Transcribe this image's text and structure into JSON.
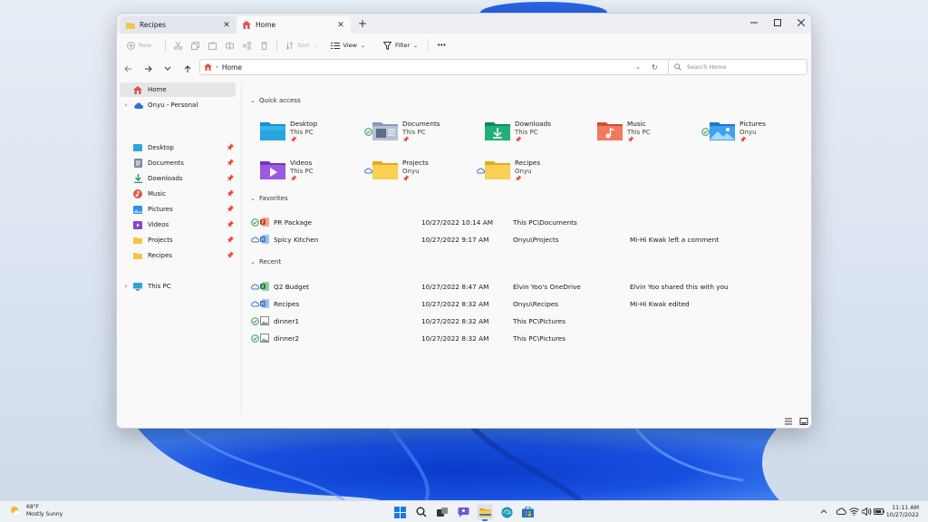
{
  "window": {
    "tabs": [
      {
        "label": "Recipes",
        "active": false
      },
      {
        "label": "Home",
        "active": true
      }
    ]
  },
  "toolbar": {
    "new_label": "New",
    "sort_label": "Sort",
    "view_label": "View",
    "filter_label": "Filter",
    "more_label": "•••"
  },
  "address": {
    "path": "Home",
    "search_placeholder": "Search Home"
  },
  "sidebar": {
    "top": [
      {
        "label": "Home"
      },
      {
        "label": "Onyu - Personal"
      }
    ],
    "pinned": [
      {
        "label": "Desktop"
      },
      {
        "label": "Documents"
      },
      {
        "label": "Downloads"
      },
      {
        "label": "Music"
      },
      {
        "label": "Pictures"
      },
      {
        "label": "Videos"
      },
      {
        "label": "Projects"
      },
      {
        "label": "Recipes"
      }
    ],
    "this_pc": "This PC"
  },
  "sections": {
    "quick_access": "Quick access",
    "favorites": "Favorites",
    "recent": "Recent"
  },
  "quick_access": [
    {
      "name": "Desktop",
      "location": "This PC"
    },
    {
      "name": "Documents",
      "location": "This PC"
    },
    {
      "name": "Downloads",
      "location": "This PC"
    },
    {
      "name": "Music",
      "location": "This PC"
    },
    {
      "name": "Pictures",
      "location": "Onyu"
    },
    {
      "name": "Videos",
      "location": "This PC"
    },
    {
      "name": "Projects",
      "location": "Onyu"
    },
    {
      "name": "Recipes",
      "location": "Onyu"
    }
  ],
  "favorites": [
    {
      "name": "PR Package",
      "date": "10/27/2022 10:14 AM",
      "location": "This PC\\Documents",
      "activity": ""
    },
    {
      "name": "Spicy Kitchen",
      "date": "10/27/2022 9:17 AM",
      "location": "Onyu\\Projects",
      "activity": "Mi-Hi Kwak left a comment"
    }
  ],
  "recent": [
    {
      "name": "Q2 Budget",
      "date": "10/27/2022 8:47 AM",
      "location": "Elvin Yoo's OneDrive",
      "activity": "Elvin Yoo shared this with you"
    },
    {
      "name": "Recipes",
      "date": "10/27/2022 8:32 AM",
      "location": "Onyu\\Recipes",
      "activity": "Mi-Hi Kwak edited"
    },
    {
      "name": "dinner1",
      "date": "10/27/2022 8:32 AM",
      "location": "This PC\\Pictures",
      "activity": ""
    },
    {
      "name": "dinner2",
      "date": "10/27/2022 8:32 AM",
      "location": "This PC\\Pictures",
      "activity": ""
    }
  ],
  "taskbar": {
    "weather_temp": "68°F",
    "weather_desc": "Mostly Sunny",
    "time": "11:11 AM",
    "date": "10/27/2022"
  },
  "colors": {
    "accent": "#3a6fd1",
    "synced_green": "#2e9b4a",
    "cloud_blue": "#3a78c9",
    "folder_yellow": "#f5c545"
  }
}
